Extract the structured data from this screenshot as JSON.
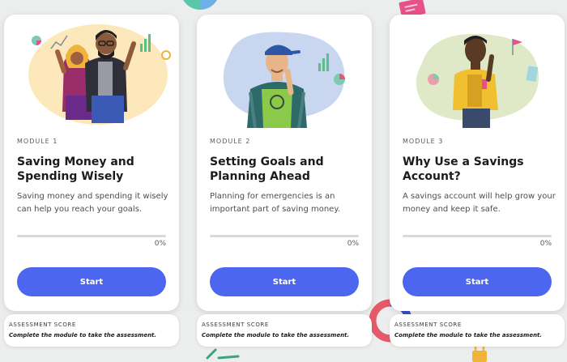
{
  "colors": {
    "accent": "#4d66f0",
    "background": "#eceeee",
    "card": "#ffffff",
    "track": "#d9dadd"
  },
  "modules": [
    {
      "label": "MODULE 1",
      "title": "Saving Money and Spending Wisely",
      "description": "Saving money and spending it wisely can help you reach your goals.",
      "progress_text": "0%",
      "progress": 0,
      "button_label": "Start",
      "illustration": "two-people-waving-illustration",
      "assessment": {
        "label": "ASSESSMENT SCORE",
        "note": "Complete the module to take the assessment."
      }
    },
    {
      "label": "MODULE 2",
      "title": "Setting Goals and Planning Ahead",
      "description": "Planning for emergencies is an important part of saving money.",
      "progress_text": "0%",
      "progress": 0,
      "button_label": "Start",
      "illustration": "thinking-person-illustration",
      "assessment": {
        "label": "ASSESSMENT SCORE",
        "note": "Complete the module to take the assessment."
      }
    },
    {
      "label": "MODULE 3",
      "title": "Why Use a Savings Account?",
      "description": "A savings account will help grow your money and keep it safe.",
      "progress_text": "0%",
      "progress": 0,
      "button_label": "Start",
      "illustration": "person-yellow-jacket-illustration",
      "assessment": {
        "label": "ASSESSMENT SCORE",
        "note": "Complete the module to take the assessment."
      }
    }
  ]
}
